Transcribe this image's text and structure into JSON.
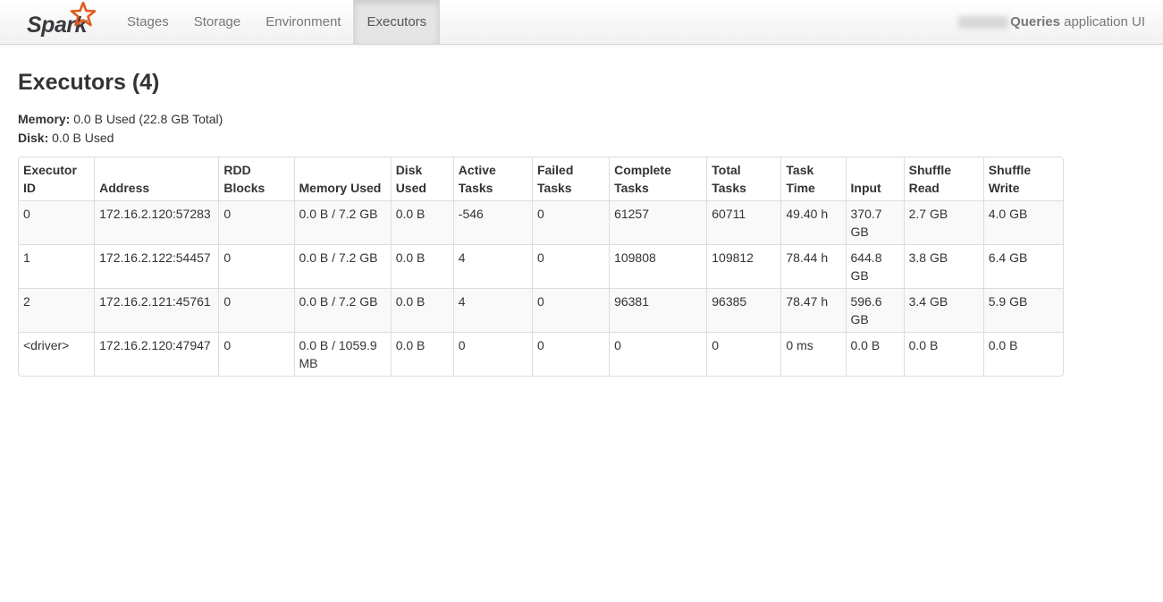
{
  "header": {
    "brand": "Spark",
    "nav": [
      {
        "label": "Stages"
      },
      {
        "label": "Storage"
      },
      {
        "label": "Environment"
      },
      {
        "label": "Executors"
      }
    ],
    "active_tab": "Executors",
    "app_name_bold": "Queries",
    "app_name_rest": " application UI"
  },
  "page": {
    "title": "Executors (4)",
    "memory_label": "Memory:",
    "memory_value": "0.0 B Used (22.8 GB Total)",
    "disk_label": "Disk:",
    "disk_value": "0.0 B Used"
  },
  "table": {
    "columns": [
      {
        "line1": "Executor",
        "line2": "ID"
      },
      {
        "line1": "",
        "line2": "Address"
      },
      {
        "line1": "RDD",
        "line2": "Blocks"
      },
      {
        "line1": "",
        "line2": "Memory Used"
      },
      {
        "line1": "Disk",
        "line2": "Used"
      },
      {
        "line1": "Active",
        "line2": "Tasks"
      },
      {
        "line1": "Failed",
        "line2": "Tasks"
      },
      {
        "line1": "Complete",
        "line2": "Tasks"
      },
      {
        "line1": "Total",
        "line2": "Tasks"
      },
      {
        "line1": "Task",
        "line2": "Time"
      },
      {
        "line1": "",
        "line2": "Input"
      },
      {
        "line1": "Shuffle",
        "line2": "Read"
      },
      {
        "line1": "Shuffle",
        "line2": "Write"
      }
    ],
    "rows": [
      [
        "0",
        "172.16.2.120:57283",
        "0",
        "0.0 B / 7.2 GB",
        "0.0 B",
        "-546",
        "0",
        "61257",
        "60711",
        "49.40 h",
        "370.7 GB",
        "2.7 GB",
        "4.0 GB"
      ],
      [
        "1",
        "172.16.2.122:54457",
        "0",
        "0.0 B / 7.2 GB",
        "0.0 B",
        "4",
        "0",
        "109808",
        "109812",
        "78.44 h",
        "644.8 GB",
        "3.8 GB",
        "6.4 GB"
      ],
      [
        "2",
        "172.16.2.121:45761",
        "0",
        "0.0 B / 7.2 GB",
        "0.0 B",
        "4",
        "0",
        "96381",
        "96385",
        "78.47 h",
        "596.6 GB",
        "3.4 GB",
        "5.9 GB"
      ],
      [
        "<driver>",
        "172.16.2.120:47947",
        "0",
        "0.0 B / 1059.9 MB",
        "0.0 B",
        "0",
        "0",
        "0",
        "0",
        "0 ms",
        "0.0 B",
        "0.0 B",
        "0.0 B"
      ]
    ]
  },
  "colors": {
    "brand_star": "#e25a1c",
    "brand_text": "#3c3a3e",
    "table_border": "#dddddd",
    "row_stripe": "#f9f9f9"
  }
}
